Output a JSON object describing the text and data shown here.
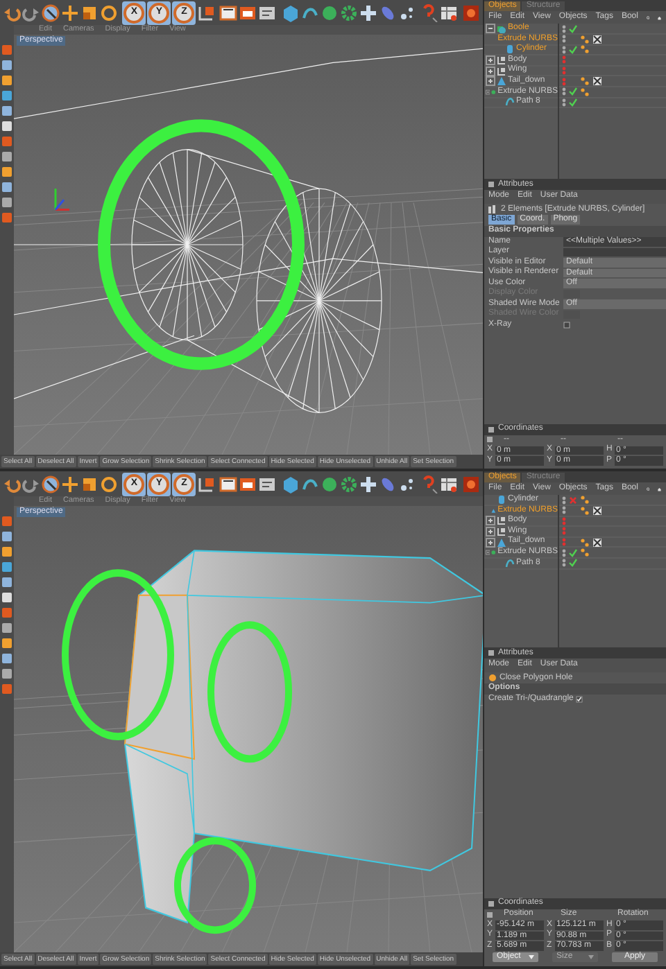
{
  "screens": [
    {
      "toolbar": {
        "axes": [
          {
            "label": "X",
            "selected": true
          },
          {
            "label": "Y",
            "selected": true
          },
          {
            "label": "Z",
            "selected": true
          }
        ]
      },
      "viewport": {
        "menu": [
          "Edit",
          "Cameras",
          "Display",
          "Filter",
          "View"
        ],
        "label": "Perspective",
        "wireframe": true
      },
      "objects": {
        "tabs": [
          {
            "label": "Objects",
            "selected": true
          },
          {
            "label": "Structure",
            "selected": false
          }
        ],
        "menu": [
          "File",
          "Edit",
          "View",
          "Objects",
          "Tags",
          "Bool"
        ],
        "tree": [
          {
            "label": "Boole",
            "kind": "boole",
            "selected": true,
            "expanded": true,
            "visible": true,
            "enabled": true,
            "phong_tag": false,
            "selection_tag": false,
            "children": [
              {
                "label": "Extrude NURBS",
                "kind": "extrude",
                "selected": true,
                "visible": true,
                "phong_tag": true,
                "selection_tag": true
              },
              {
                "label": "Cylinder",
                "kind": "cylinder",
                "selected": true,
                "visible": true,
                "enabled": true,
                "phong_tag": true,
                "selection_tag": false
              }
            ]
          },
          {
            "label": "Body",
            "kind": "null",
            "selected": false,
            "expanded": false,
            "visible": false,
            "phong_tag": false,
            "selection_tag": false
          },
          {
            "label": "Wing",
            "kind": "null",
            "selected": false,
            "expanded": false,
            "visible": false,
            "phong_tag": false,
            "selection_tag": false
          },
          {
            "label": "Tail_down",
            "kind": "extrude",
            "selected": false,
            "expanded": false,
            "visible": false,
            "phong_tag": true,
            "selection_tag": true
          },
          {
            "label": "Extrude NURBS",
            "kind": "extrude_green",
            "selected": false,
            "expanded": true,
            "visible": true,
            "enabled": true,
            "phong_tag": true,
            "selection_tag": false,
            "children": [
              {
                "label": "Path 8",
                "kind": "spline",
                "selected": false,
                "visible": true,
                "enabled": true,
                "phong_tag": false,
                "selection_tag": false
              }
            ]
          }
        ]
      },
      "attributes": {
        "title": "Attributes",
        "menu": [
          "Mode",
          "Edit",
          "User Data"
        ],
        "heading": "2 Elements [Extrude NURBS, Cylinder]",
        "tabs": [
          {
            "label": "Basic",
            "selected": true
          },
          {
            "label": "Coord.",
            "selected": false
          },
          {
            "label": "Phong",
            "selected": false
          }
        ],
        "section": "Basic Properties",
        "fields": [
          {
            "label": "Name",
            "kind": "text",
            "value": "<<Multiple Values>>",
            "disabled": false
          },
          {
            "label": "Layer",
            "kind": "text",
            "disabled": false
          },
          {
            "label": "Visible in Editor",
            "kind": "dropdown",
            "value": "Default",
            "disabled": false
          },
          {
            "label": "Visible in Renderer",
            "kind": "dropdown",
            "value": "Default",
            "disabled": false
          },
          {
            "label": "Use Color",
            "kind": "dropdown",
            "value": "Off",
            "disabled": false
          },
          {
            "label": "Display Color",
            "kind": "color",
            "disabled": true
          },
          {
            "label": "Shaded Wire Mode",
            "kind": "dropdown",
            "value": "Off",
            "disabled": false
          },
          {
            "label": "Shaded Wire Color",
            "kind": "color",
            "disabled": true
          },
          {
            "label": "X-Ray",
            "kind": "checkbox",
            "checked": false,
            "disabled": false
          }
        ]
      },
      "coordinates": {
        "title": "Coordinates",
        "columns": [
          "--",
          "--",
          "--"
        ],
        "rows": [
          [
            {
              "axis": "X",
              "value": "0 m"
            },
            {
              "axis": "X",
              "value": "0 m"
            },
            {
              "axis": "H",
              "value": "0 °"
            }
          ],
          [
            {
              "axis": "Y",
              "value": "0 m"
            },
            {
              "axis": "Y",
              "value": "0 m"
            },
            {
              "axis": "P",
              "value": "0 °"
            }
          ]
        ]
      },
      "command_bar": [
        "Select All",
        "Deselect All",
        "Invert",
        "Grow Selection",
        "Shrink Selection",
        "Select Connected",
        "Hide Selected",
        "Hide Unselected",
        "Unhide All",
        "Set Selection"
      ]
    },
    {
      "toolbar": {
        "axes": [
          {
            "label": "X",
            "selected": true
          },
          {
            "label": "Y",
            "selected": true
          },
          {
            "label": "Z",
            "selected": true
          }
        ]
      },
      "viewport": {
        "menu": [
          "Edit",
          "Cameras",
          "Display",
          "Filter",
          "View"
        ],
        "label": "Perspective",
        "wireframe": false
      },
      "objects": {
        "tabs": [
          {
            "label": "Objects",
            "selected": true
          },
          {
            "label": "Structure",
            "selected": false
          }
        ],
        "menu": [
          "File",
          "Edit",
          "View",
          "Objects",
          "Tags",
          "Bool"
        ],
        "tree": [
          {
            "label": "Cylinder",
            "kind": "cylinder",
            "selected": false,
            "visible": true,
            "enabled": false,
            "phong_tag": true,
            "selection_tag": false
          },
          {
            "label": "Extrude NURBS",
            "kind": "extrude",
            "selected": true,
            "visible": true,
            "phong_tag": true,
            "selection_tag": true
          },
          {
            "label": "Body",
            "kind": "null",
            "selected": false,
            "expanded": false,
            "visible": false,
            "phong_tag": false,
            "selection_tag": false
          },
          {
            "label": "Wing",
            "kind": "null",
            "selected": false,
            "expanded": false,
            "visible": false,
            "phong_tag": false,
            "selection_tag": false
          },
          {
            "label": "Tail_down",
            "kind": "extrude",
            "selected": false,
            "expanded": false,
            "visible": false,
            "phong_tag": true,
            "selection_tag": true
          },
          {
            "label": "Extrude NURBS",
            "kind": "extrude_green",
            "selected": false,
            "expanded": true,
            "visible": true,
            "enabled": true,
            "phong_tag": true,
            "selection_tag": false,
            "children": [
              {
                "label": "Path 8",
                "kind": "spline",
                "selected": false,
                "visible": true,
                "enabled": true,
                "phong_tag": false,
                "selection_tag": false
              }
            ]
          }
        ]
      },
      "attributes": {
        "title": "Attributes",
        "menu": [
          "Mode",
          "Edit",
          "User Data"
        ],
        "tool": "Close Polygon Hole",
        "section": "Options",
        "fields": [
          {
            "label": "Create Tri-/Quadrangle",
            "kind": "inline_checkbox",
            "checked": true
          }
        ]
      },
      "coordinates": {
        "title": "Coordinates",
        "columns": [
          "Position",
          "Size",
          "Rotation"
        ],
        "rows": [
          [
            {
              "axis": "X",
              "value": "-95.142 m"
            },
            {
              "axis": "X",
              "value": "125.121 m"
            },
            {
              "axis": "H",
              "value": "0 °"
            }
          ],
          [
            {
              "axis": "Y",
              "value": "1.189 m"
            },
            {
              "axis": "Y",
              "value": "90.88 m"
            },
            {
              "axis": "P",
              "value": "0 °"
            }
          ],
          [
            {
              "axis": "Z",
              "value": "5.689 m"
            },
            {
              "axis": "Z",
              "value": "70.783 m"
            },
            {
              "axis": "B",
              "value": "0 °"
            }
          ]
        ],
        "buttons": [
          {
            "label": "Object",
            "kind": "dropdown",
            "disabled": false
          },
          {
            "label": "Size",
            "kind": "dropdown",
            "disabled": true
          },
          {
            "label": "Apply",
            "kind": "button",
            "disabled": false
          }
        ]
      },
      "command_bar": [
        "Select All",
        "Deselect All",
        "Invert",
        "Grow Selection",
        "Shrink Selection",
        "Select Connected",
        "Hide Selected",
        "Hide Unselected",
        "Unhide All",
        "Set Selection"
      ]
    }
  ]
}
